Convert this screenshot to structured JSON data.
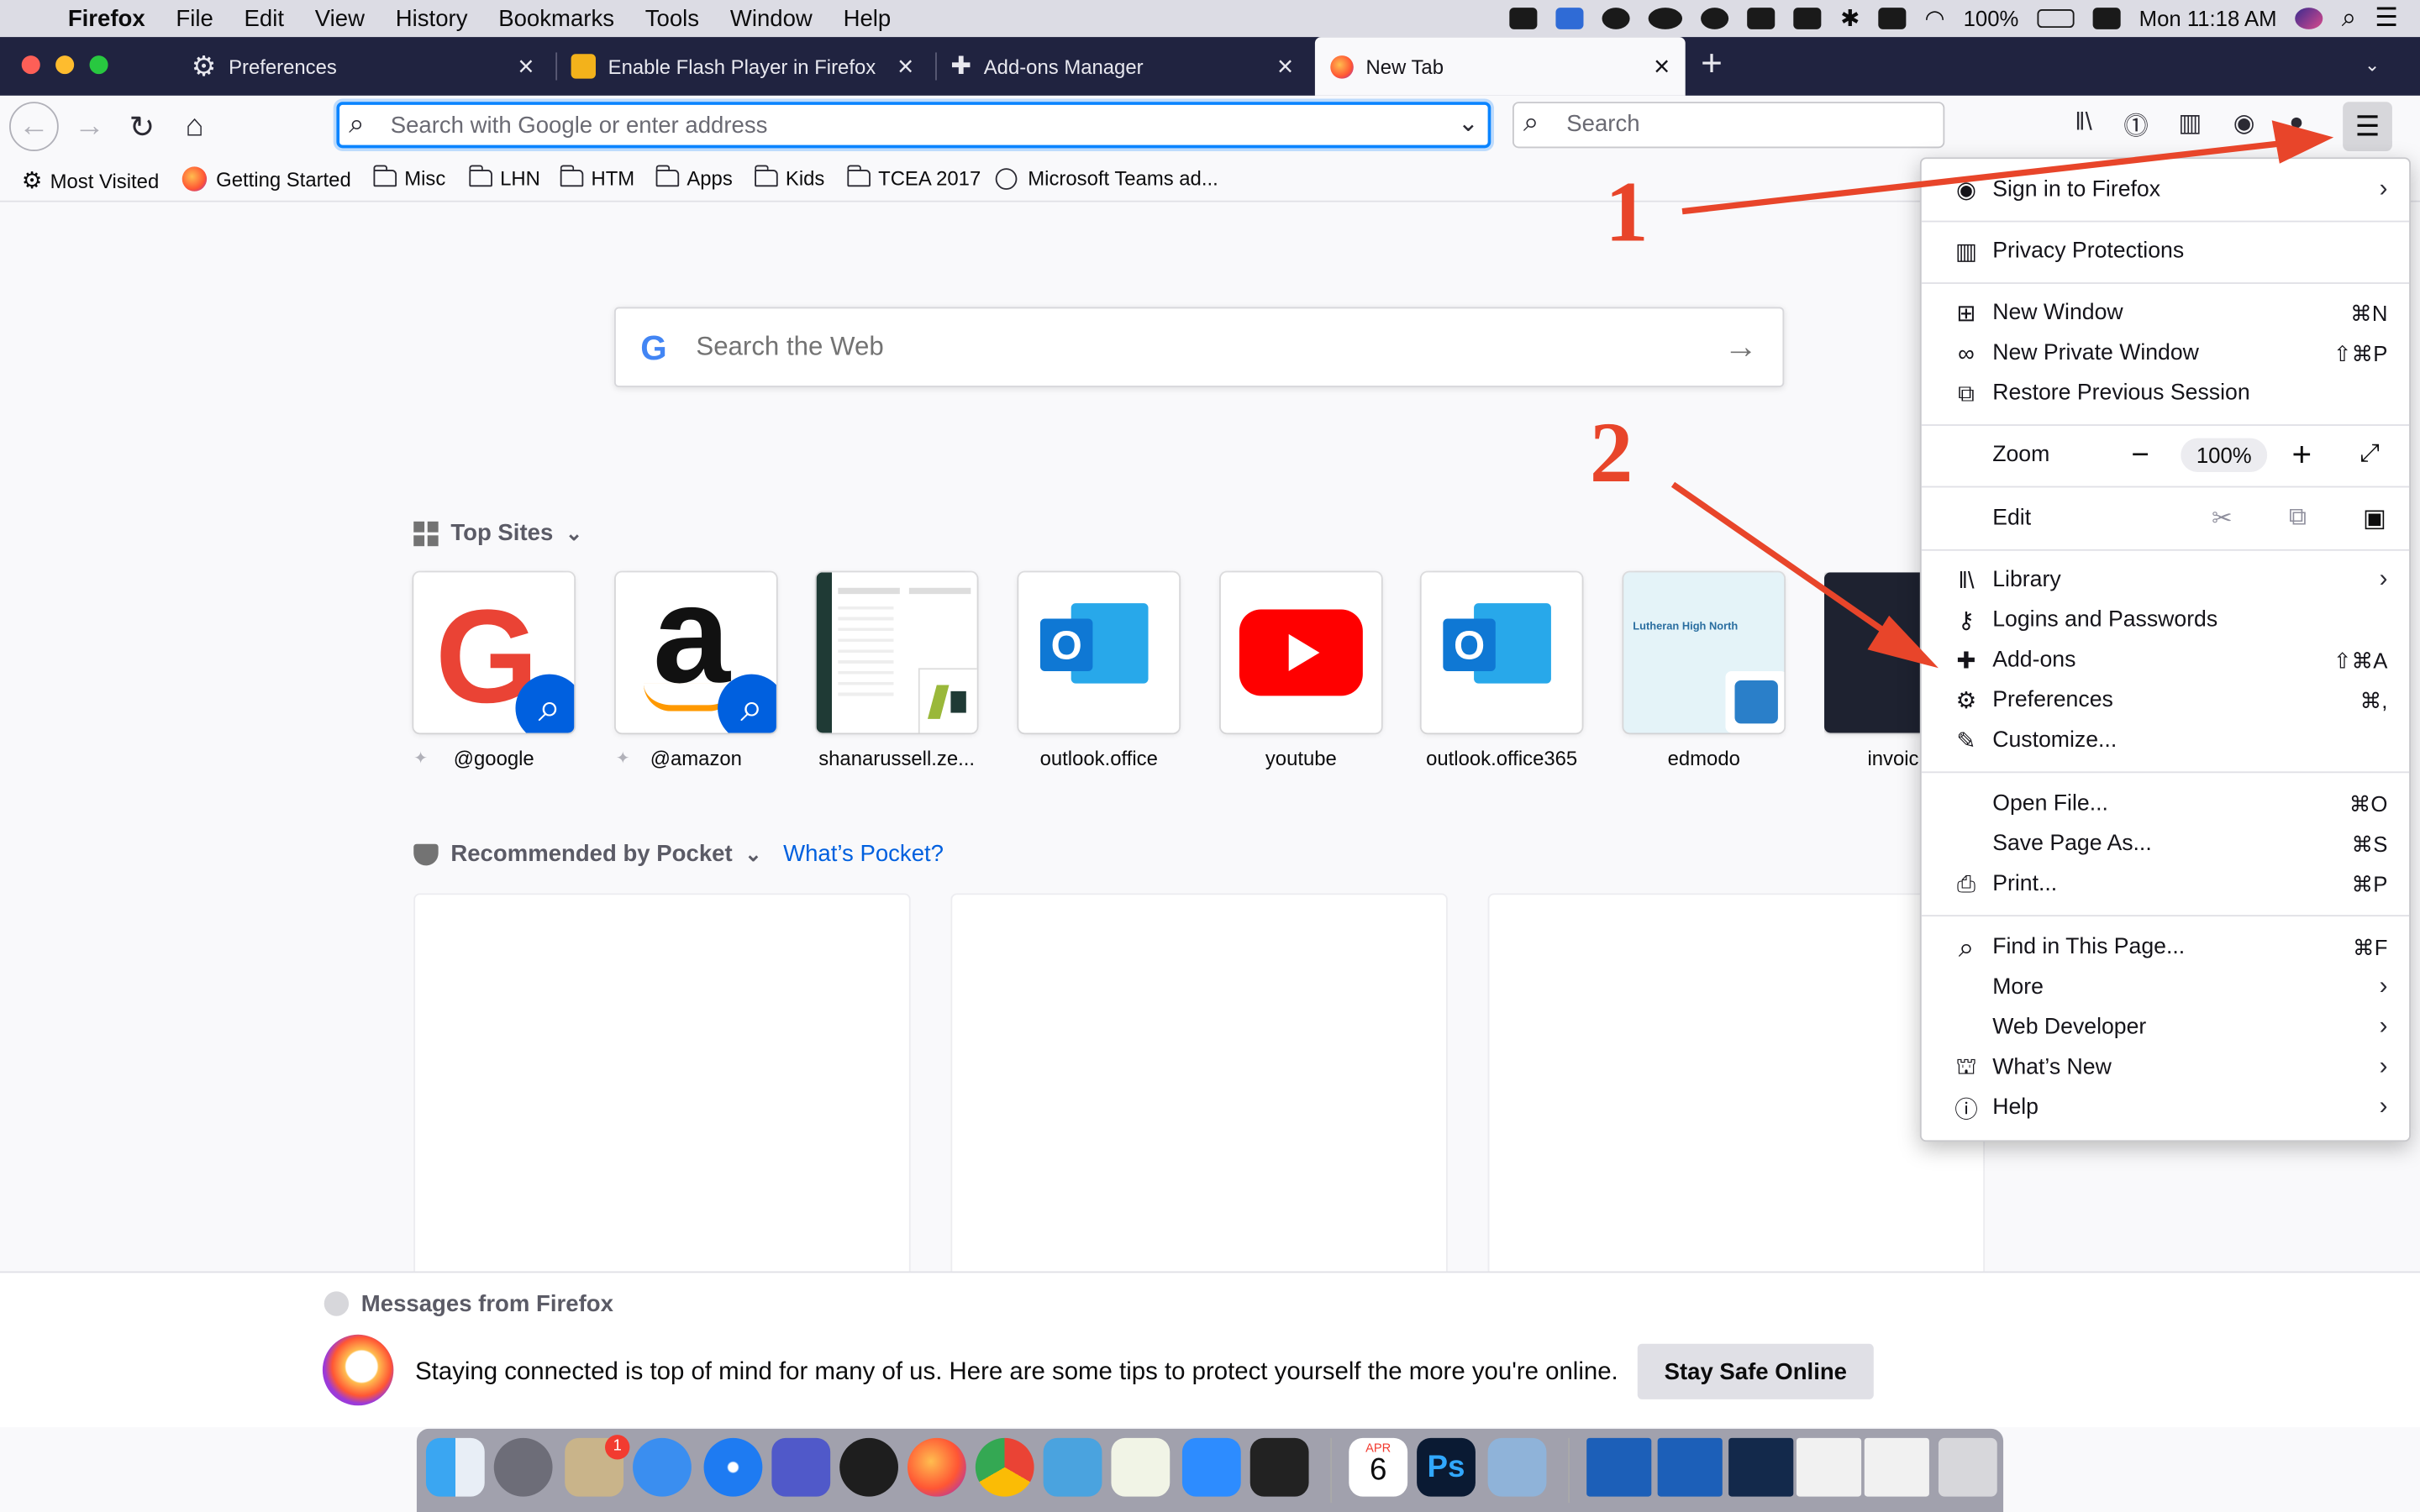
{
  "menubar": {
    "app_name": "Firefox",
    "items": [
      "File",
      "Edit",
      "View",
      "History",
      "Bookmarks",
      "Tools",
      "Window",
      "Help"
    ],
    "battery": "100%",
    "clock": "Mon 11:18 AM"
  },
  "tabs": [
    {
      "label": "Preferences"
    },
    {
      "label": "Enable Flash Player in Firefox –"
    },
    {
      "label": "Add-ons Manager"
    },
    {
      "label": "New Tab"
    }
  ],
  "navbar": {
    "url_placeholder": "Search with Google or enter address",
    "search_placeholder": "Search"
  },
  "bookmarks": [
    {
      "label": "Most Visited"
    },
    {
      "label": "Getting Started"
    },
    {
      "label": "Misc"
    },
    {
      "label": "LHN"
    },
    {
      "label": "HTM"
    },
    {
      "label": "Apps"
    },
    {
      "label": "Kids"
    },
    {
      "label": "TCEA 2017"
    },
    {
      "label": "Microsoft Teams ad..."
    }
  ],
  "newtab": {
    "search_placeholder": "Search the Web",
    "top_sites_title": "Top Sites",
    "tiles": [
      {
        "label": "@google"
      },
      {
        "label": "@amazon"
      },
      {
        "label": "shanarussell.ze..."
      },
      {
        "label": "outlook.office"
      },
      {
        "label": "youtube"
      },
      {
        "label": "outlook.office365"
      },
      {
        "label": "edmodo"
      },
      {
        "label": "invoic"
      }
    ],
    "edmodo_heading": "Lutheran High North",
    "pocket_title": "Recommended by Pocket",
    "whats_pocket": "What’s Pocket?"
  },
  "messages": {
    "title": "Messages from Firefox",
    "body": "Staying connected is top of mind for many of us. Here are some tips to protect yourself the more you're online.",
    "button": "Stay Safe Online"
  },
  "dock": {
    "badge_count": "1",
    "calendar_month": "APR",
    "calendar_day": "6",
    "ps_label": "Ps"
  },
  "menu": {
    "sign_in": "Sign in to Firefox",
    "privacy": "Privacy Protections",
    "new_window": "New Window",
    "new_window_sc": "⌘N",
    "private_window": "New Private Window",
    "private_window_sc": "⇧⌘P",
    "restore": "Restore Previous Session",
    "zoom": "Zoom",
    "zoom_minus": "−",
    "zoom_value": "100%",
    "zoom_plus": "+",
    "edit": "Edit",
    "library": "Library",
    "logins": "Logins and Passwords",
    "addons": "Add-ons",
    "addons_sc": "⇧⌘A",
    "preferences": "Preferences",
    "preferences_sc": "⌘,",
    "customize": "Customize...",
    "open_file": "Open File...",
    "open_file_sc": "⌘O",
    "save_page": "Save Page As...",
    "save_page_sc": "⌘S",
    "print": "Print...",
    "print_sc": "⌘P",
    "find": "Find in This Page...",
    "find_sc": "⌘F",
    "more": "More",
    "web_dev": "Web Developer",
    "whats_new": "What’s New",
    "help": "Help"
  },
  "annotations": {
    "step1": "1",
    "step2": "2",
    "arrow_color": "#e8452a"
  },
  "colors": {
    "accent": "#0a84ff",
    "tabstrip": "#202340"
  }
}
